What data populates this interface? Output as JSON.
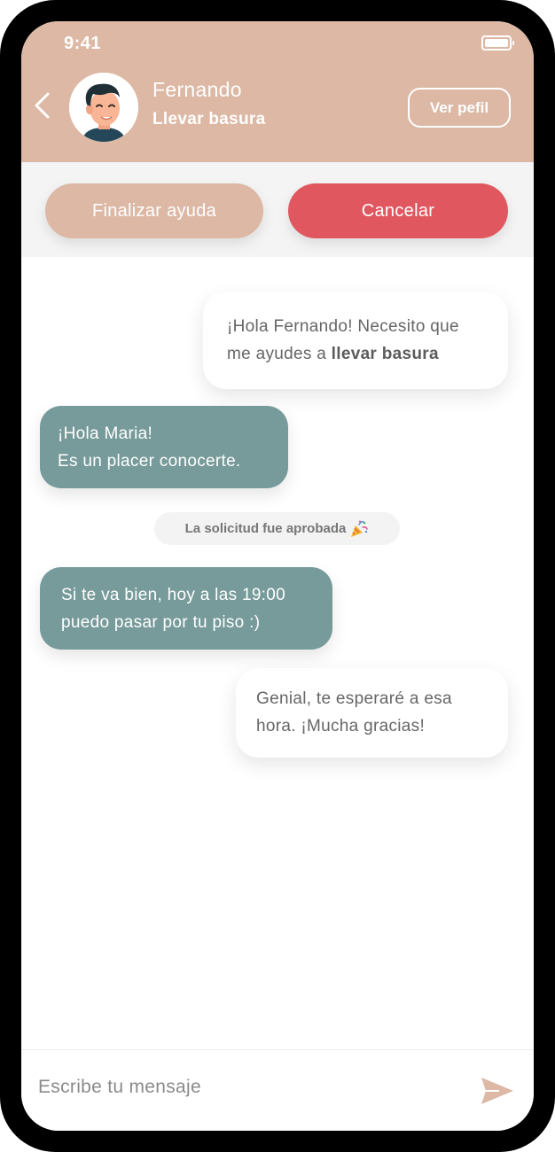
{
  "status_bar": {
    "time": "9:41"
  },
  "header": {
    "name": "Fernando",
    "task": "Llevar basura",
    "profile_button": "Ver pefil"
  },
  "actions": {
    "finish_label": "Finalizar ayuda",
    "cancel_label": "Cancelar"
  },
  "messages": [
    {
      "direction": "outgoing",
      "line1": "¡Hola Fernando! Necesito que",
      "line2_prefix": "me ayudes a ",
      "line2_bold": "llevar basura"
    },
    {
      "direction": "incoming",
      "line1": "¡Hola Maria!",
      "line2": "Es un placer conocerte."
    },
    {
      "direction": "incoming",
      "line1": "Si te va bien, hoy a las 19:00",
      "line2": "puedo pasar por tu piso :)"
    },
    {
      "direction": "outgoing",
      "line1": "Genial, te esperaré a esa",
      "line2": "hora. ¡Mucha gracias!"
    }
  ],
  "system_message": {
    "text": "La solicitud fue aprobada",
    "icon": "party-popper-icon"
  },
  "composer": {
    "placeholder": "Escribe tu mensaje",
    "value": ""
  },
  "icons": {
    "back": "chevron-left-icon",
    "send": "send-icon",
    "battery": "battery-icon",
    "avatar": "avatar"
  },
  "colors": {
    "header": "#dcb8a5",
    "cancel": "#e05760",
    "incoming_bubble": "#779a9a",
    "outgoing_bubble": "#ffffff",
    "send_icon": "#dcb8a5"
  }
}
